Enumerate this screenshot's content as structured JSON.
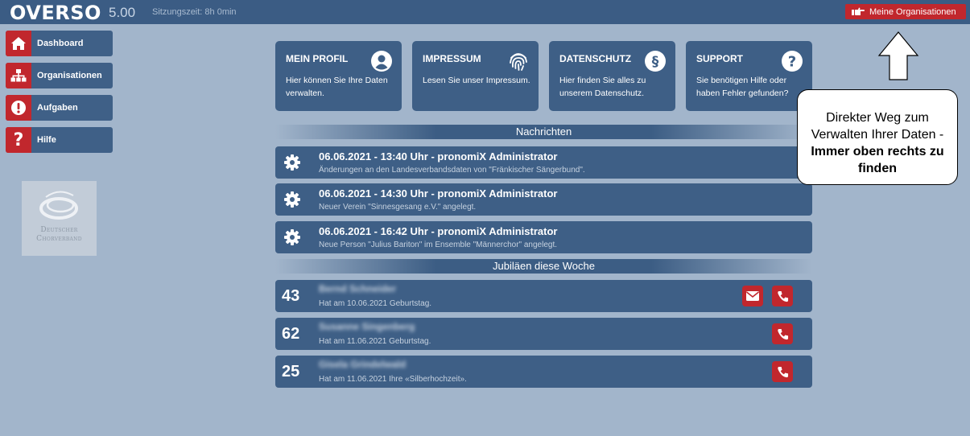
{
  "topbar": {
    "logo": "OVERSO",
    "version": "5.00",
    "session": "Sitzungszeit: 8h 0min",
    "org_button": "Meine Organisationen",
    "org_button_icon": "hand-point-right-icon"
  },
  "sidebar": {
    "items": [
      {
        "label": "Dashboard",
        "icon": "home-icon"
      },
      {
        "label": "Organisationen",
        "icon": "sitemap-icon"
      },
      {
        "label": "Aufgaben",
        "icon": "exclamation-icon"
      },
      {
        "label": "Hilfe",
        "icon": "question-icon"
      }
    ],
    "logo_text_line1": "Deutscher",
    "logo_text_line2": "Chorverband"
  },
  "cards": [
    {
      "title": "MEIN PROFIL",
      "text": "Hier können Sie Ihre Daten verwalten.",
      "icon": "user-circle-icon"
    },
    {
      "title": "IMPRESSUM",
      "text": "Lesen Sie unser Impressum.",
      "icon": "fingerprint-icon"
    },
    {
      "title": "DATENSCHUTZ",
      "text": "Hier finden Sie alles zu unserem Datenschutz.",
      "icon": "paragraph-icon"
    },
    {
      "title": "SUPPORT",
      "text": "Sie benötigen Hilfe oder haben Fehler gefunden?",
      "icon": "question-circle-icon"
    }
  ],
  "news": {
    "header": "Nachrichten",
    "items": [
      {
        "title": "06.06.2021 - 13:40 Uhr - pronomiX Administrator",
        "text": "Änderungen an den Landesverbandsdaten von \"Fränkischer Sängerbund\"."
      },
      {
        "title": "06.06.2021 - 14:30 Uhr - pronomiX Administrator",
        "text": "Neuer Verein \"Sinnesgesang e.V.\" angelegt."
      },
      {
        "title": "06.06.2021 - 16:42 Uhr - pronomiX Administrator",
        "text": "Neue Person \"Julius Bariton\" im Ensemble \"Männerchor\" angelegt."
      }
    ]
  },
  "jubilees": {
    "header": "Jubiläen diese Woche",
    "items": [
      {
        "number": "43",
        "name": "Bernd Schneider",
        "text": "Hat am 10.06.2021 Geburtstag.",
        "buttons": [
          "mail",
          "phone"
        ]
      },
      {
        "number": "62",
        "name": "Susanne Singenberg",
        "text": "Hat am 11.06.2021 Geburtstag.",
        "buttons": [
          "phone"
        ]
      },
      {
        "number": "25",
        "name": "Gisela Grindelwald",
        "text": "Hat am 11.06.2021 Ihre «Silberhochzeit».",
        "buttons": [
          "phone"
        ]
      }
    ]
  },
  "callout": {
    "line1": "Direkter Weg zum",
    "line2": "Verwalten Ihrer Daten -",
    "line3": "Immer oben rechts zu",
    "line4": "finden"
  },
  "colors": {
    "background": "#a2b5cb",
    "topbar": "#3b5c84",
    "panel": "#3e5f86",
    "accent_red": "#c1272d"
  }
}
